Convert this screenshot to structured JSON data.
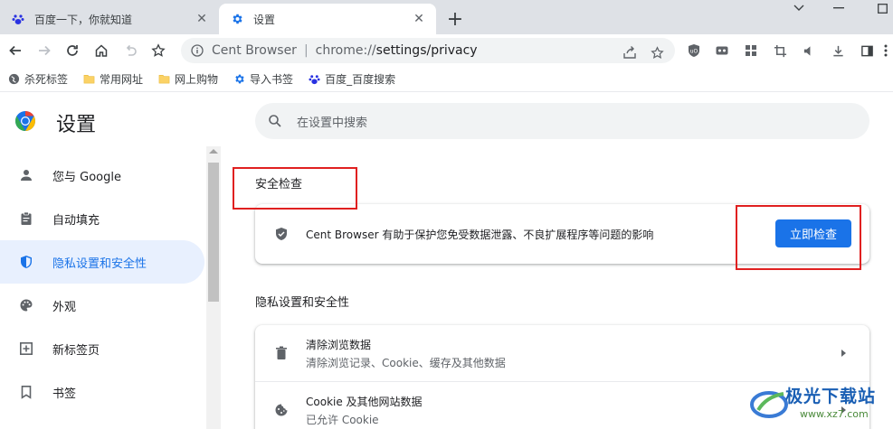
{
  "tabs": [
    {
      "title": "百度一下，你就知道",
      "icon": "baidu-paw-icon",
      "active": false
    },
    {
      "title": "设置",
      "icon": "gear-icon",
      "active": true
    }
  ],
  "toolbar": {
    "host": "Cent Browser",
    "scheme": "chrome://",
    "path": "settings/privacy"
  },
  "bookmarks": [
    {
      "label": "杀死标签",
      "icon": "globe-icon"
    },
    {
      "label": "常用网址",
      "icon": "folder-icon"
    },
    {
      "label": "网上购物",
      "icon": "folder-icon"
    },
    {
      "label": "导入书签",
      "icon": "gear-icon"
    },
    {
      "label": "百度_百度搜索",
      "icon": "baidu-paw-icon"
    }
  ],
  "settings": {
    "title": "设置",
    "search_placeholder": "在设置中搜索"
  },
  "sidebar": {
    "items": [
      {
        "label": "您与 Google",
        "icon": "person-icon",
        "active": false
      },
      {
        "label": "自动填充",
        "icon": "clipboard-icon",
        "active": false
      },
      {
        "label": "隐私设置和安全性",
        "icon": "shield-icon",
        "active": true
      },
      {
        "label": "外观",
        "icon": "palette-icon",
        "active": false
      },
      {
        "label": "新标签页",
        "icon": "new-tab-icon",
        "active": false
      },
      {
        "label": "书签",
        "icon": "bookmark-icon",
        "active": false
      }
    ]
  },
  "safety_check": {
    "title": "安全检查",
    "description": "Cent Browser 有助于保护您免受数据泄露、不良扩展程序等问题的影响",
    "button": "立即检查"
  },
  "privacy": {
    "title": "隐私设置和安全性",
    "rows": [
      {
        "title": "清除浏览数据",
        "subtitle": "清除浏览记录、Cookie、缓存及其他数据",
        "icon": "trash-icon"
      },
      {
        "title": "Cookie 及其他网站数据",
        "subtitle": "已允许 Cookie",
        "icon": "cookie-icon"
      }
    ]
  },
  "watermark": {
    "brand": "极光下载站",
    "url": "www.xz7.com"
  },
  "colors": {
    "accent": "#1a73e8",
    "annotation": "#e02020"
  }
}
